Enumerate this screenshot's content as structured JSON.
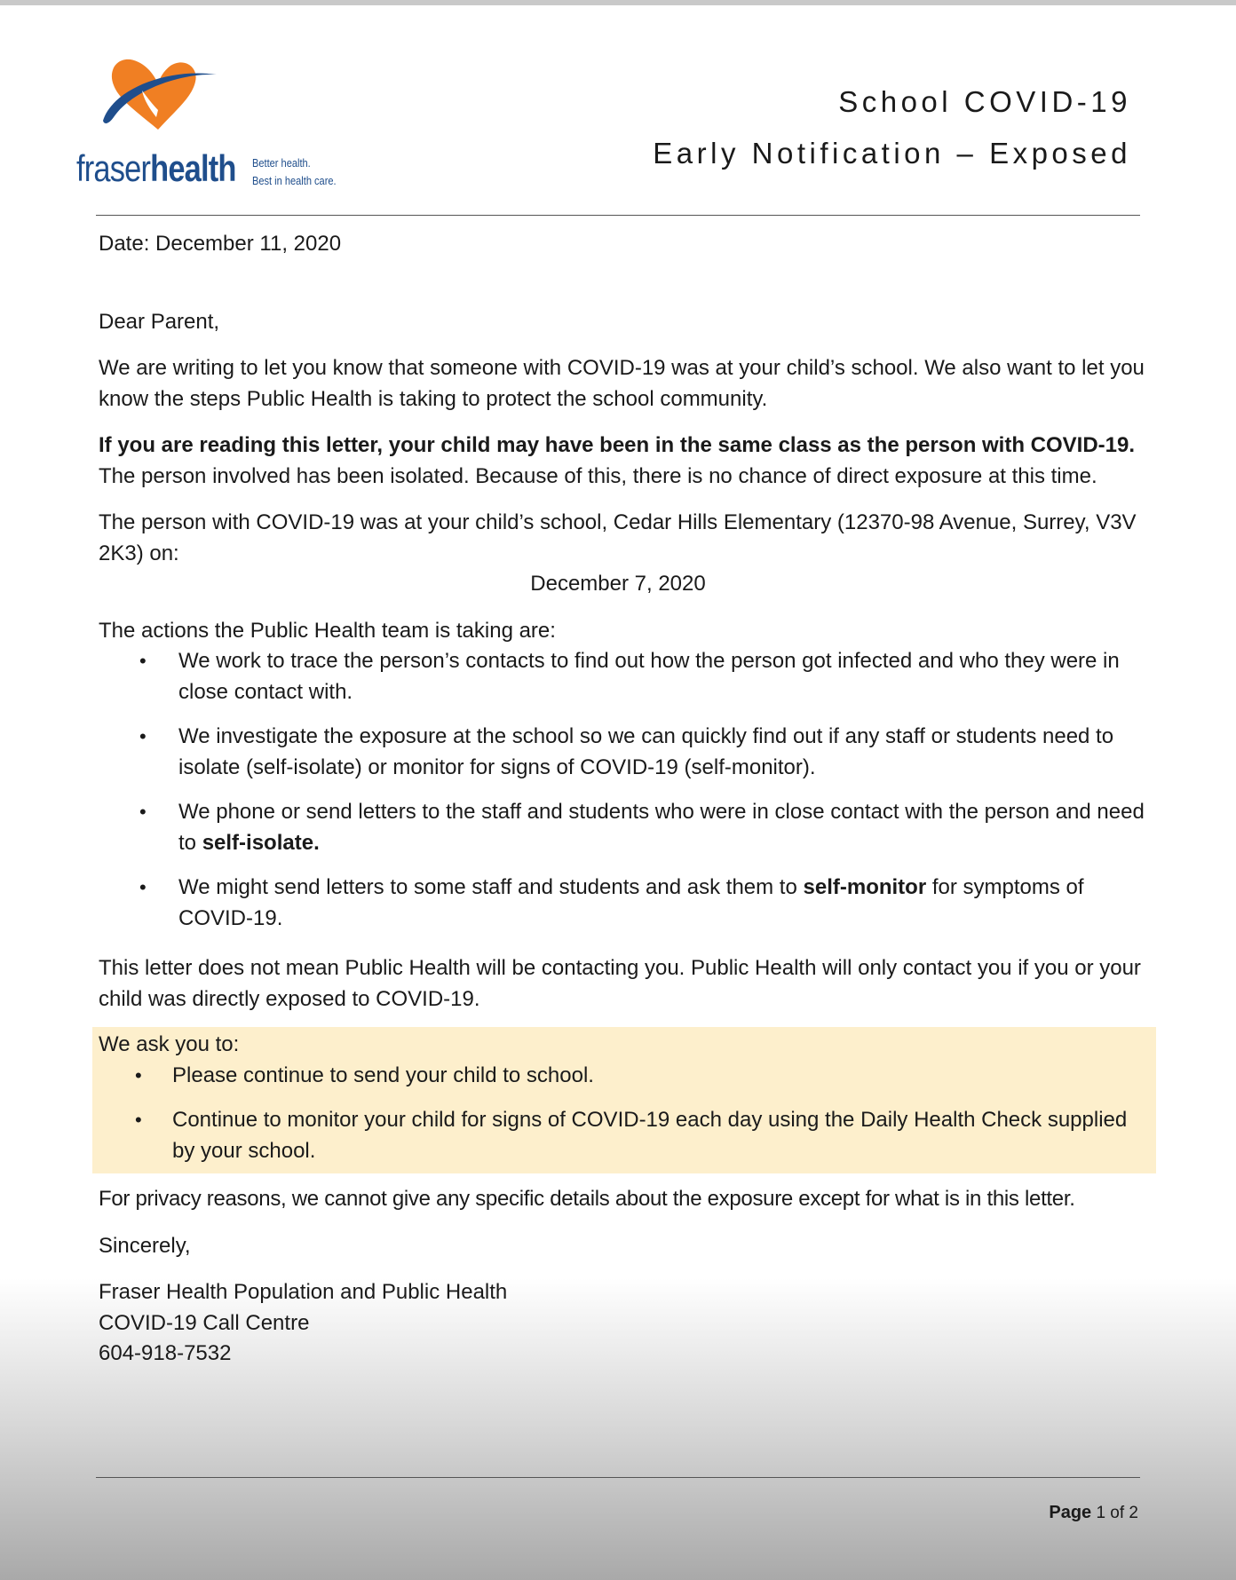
{
  "header": {
    "logo_word_1": "fraser",
    "logo_word_2": "health",
    "tagline_1": "Better health.",
    "tagline_2": "Best in health care.",
    "title_1": "School COVID-19",
    "title_2": "Early Notification – Exposed"
  },
  "letter": {
    "date": "Date: December 11, 2020",
    "salutation": "Dear Parent,",
    "intro": "We are writing to let you know that someone with COVID-19 was at your child’s school. We also want to let you know the steps Public Health is taking to protect the school community.",
    "bold_lead": "If you are reading this letter, your child may have been in the same class as the person with COVID-19.",
    "bold_lead_rest": " The person involved has been isolated. Because of this, there is no chance of direct exposure at this time.",
    "location": "The person with COVID-19 was at your child’s school, Cedar Hills Elementary (12370-98 Avenue, Surrey, V3V 2K3) on:",
    "exposure_date": "December 7, 2020",
    "actions_intro": "The actions the Public Health team is taking are:",
    "actions": [
      {
        "text": "We work to trace the person’s contacts to find out how the person got infected and who they were in close contact with."
      },
      {
        "text": "We investigate the exposure at the school so we can quickly find out if any staff or students need to isolate (self-isolate) or monitor for signs of COVID-19 (self-monitor)."
      },
      {
        "text": "We phone or send letters to the staff and students who were in close contact with the person and need to ",
        "bold": "self-isolate.",
        "after": ""
      },
      {
        "text": "We might send letters to some staff and students and ask them to ",
        "bold": "self-monitor",
        "after": " for symptoms of COVID-19."
      }
    ],
    "not_contacting": "This letter does not mean Public Health will be contacting you. Public Health will only contact you if you or your child was directly exposed to COVID-19.",
    "ask_intro": "We ask you to:",
    "asks": [
      "Please continue to send your child to school.",
      "Continue to monitor your child for signs of COVID-19 each day using the Daily Health Check supplied by your school."
    ],
    "privacy": "For privacy reasons, we cannot give any specific details about the exposure except for what is in this letter.",
    "closing": "Sincerely,",
    "signature_1": "Fraser Health Population and Public Health",
    "signature_2": "COVID-19 Call Centre",
    "signature_3": "604-918-7532"
  },
  "footer": {
    "page_label": "Page",
    "page_number": "1 of 2"
  },
  "colors": {
    "logo_orange": "#f07f23",
    "logo_blue": "#1f4e8c",
    "highlight": "#fdefcc"
  }
}
